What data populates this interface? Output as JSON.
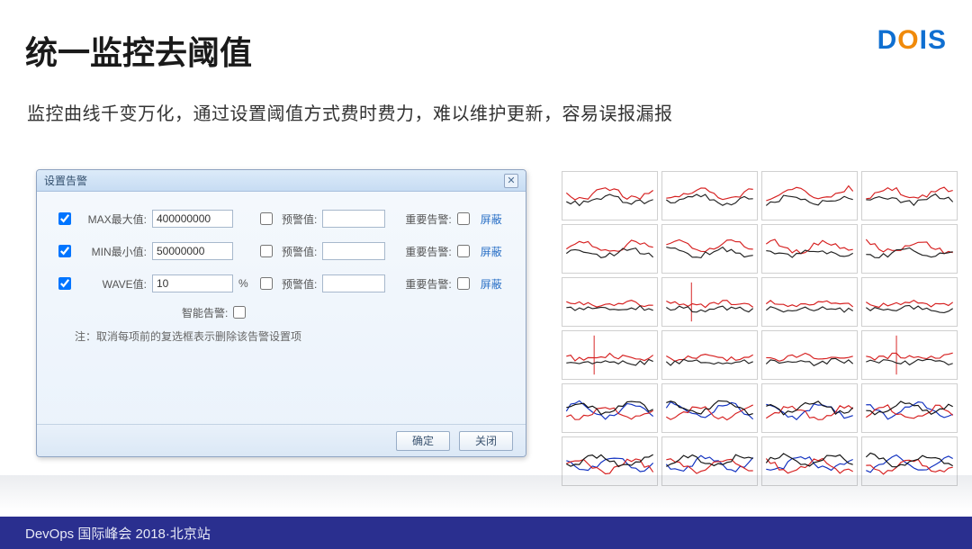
{
  "header": {
    "title": "统一监控去阈值",
    "brand": {
      "d": "D",
      "o": "O",
      "i": "I",
      "s": "S"
    }
  },
  "subtitle": "监控曲线千变万化，通过设置阈值方式费时费力，难以维护更新，容易误报漏报",
  "dialog": {
    "title": "设置告警",
    "rows": [
      {
        "checked": true,
        "label": "MAX最大值:",
        "value": "400000000",
        "unit": "",
        "pre_label": "预警值:",
        "pre_value": "",
        "imp_label": "重要告警:",
        "shield": "屏蔽"
      },
      {
        "checked": true,
        "label": "MIN最小值:",
        "value": "50000000",
        "unit": "",
        "pre_label": "预警值:",
        "pre_value": "",
        "imp_label": "重要告警:",
        "shield": "屏蔽"
      },
      {
        "checked": true,
        "label": "WAVE值:",
        "value": "10",
        "unit": "%",
        "pre_label": "预警值:",
        "pre_value": "",
        "imp_label": "重要告警:",
        "shield": "屏蔽"
      }
    ],
    "smart_label": "智能告警:",
    "note": "注：取消每项前的复选框表示删除该告警设置项",
    "ok": "确定",
    "close": "关闭"
  },
  "chart_grid": {
    "rows": 6,
    "cols": 4,
    "description": "24 small monitoring line-chart thumbnails with red/black/blue curves"
  },
  "footer": "DevOps 国际峰会 2018·北京站"
}
